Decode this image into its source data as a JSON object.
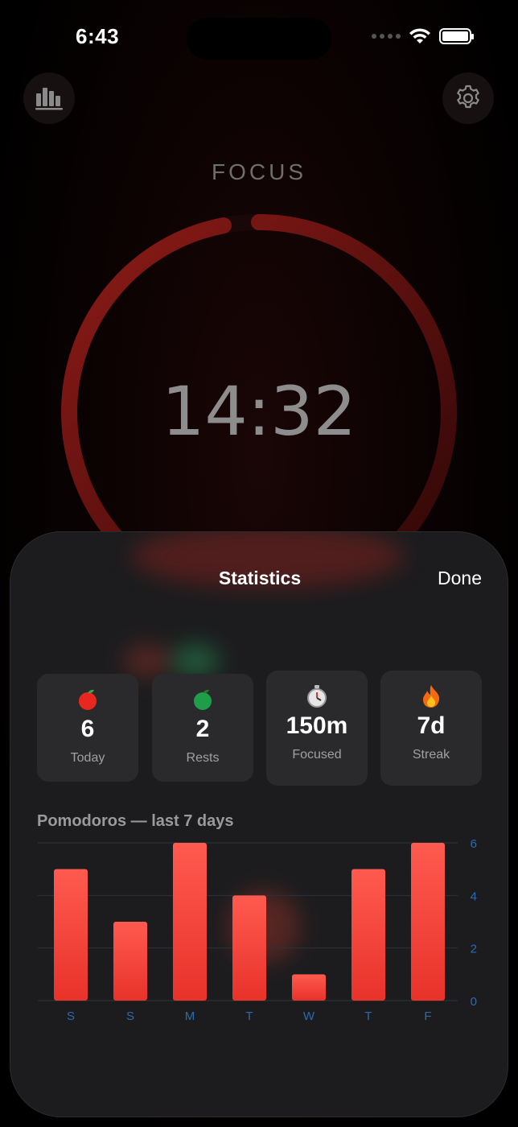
{
  "status_bar": {
    "time": "6:43"
  },
  "header": {
    "stats_icon": "bar-chart-icon",
    "settings_icon": "gear-icon"
  },
  "timer": {
    "mode": "FOCUS",
    "time_remaining": "14:32",
    "progress": 0.97,
    "accent": "#8b1a17"
  },
  "sheet": {
    "title": "Statistics",
    "done_label": "Done",
    "cards": [
      {
        "icon": "red-apple-icon",
        "value": "6",
        "label": "Today"
      },
      {
        "icon": "green-apple-icon",
        "value": "2",
        "label": "Rests"
      },
      {
        "icon": "stopwatch-icon",
        "value": "150m",
        "label": "Focused"
      },
      {
        "icon": "fire-icon",
        "value": "7d",
        "label": "Streak"
      }
    ],
    "chart_heading": "Pomodoros — last 7 days"
  },
  "chart_data": {
    "type": "bar",
    "categories": [
      "S",
      "S",
      "M",
      "T",
      "W",
      "T",
      "F"
    ],
    "values": [
      5,
      3,
      6,
      4,
      1,
      5,
      6
    ],
    "ylim": [
      0,
      6
    ],
    "yticks": [
      "0",
      "2",
      "4",
      "6"
    ],
    "grid": true,
    "bar_color": "#f23e34",
    "tick_color": "#2a6bb0"
  }
}
